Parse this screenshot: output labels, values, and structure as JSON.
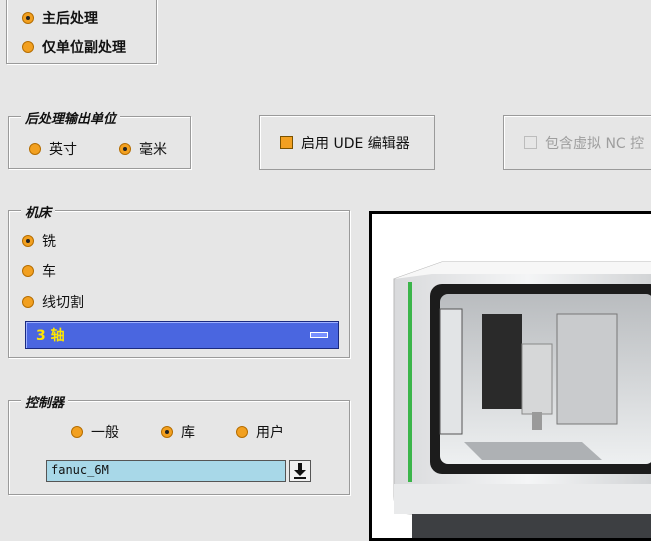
{
  "post_mode": {
    "options": [
      {
        "label": "主后处理",
        "checked": true
      },
      {
        "label": "仅单位副处理",
        "checked": false
      }
    ]
  },
  "units": {
    "title": "后处理输出单位",
    "options": [
      {
        "label": "英寸",
        "checked": false
      },
      {
        "label": "毫米",
        "checked": true
      }
    ]
  },
  "ude_button": {
    "label": "启用 UDE 编辑器",
    "checked": true
  },
  "nc_button": {
    "label": "包含虚拟 NC 控",
    "checked": false,
    "enabled": false
  },
  "machine": {
    "title": "机床",
    "options": [
      {
        "label": "铣",
        "checked": true
      },
      {
        "label": "车",
        "checked": false
      },
      {
        "label": "线切割",
        "checked": false
      }
    ],
    "axis_select": "3 轴"
  },
  "controller": {
    "title": "控制器",
    "options": [
      {
        "label": "一般",
        "checked": false
      },
      {
        "label": "库",
        "checked": true
      },
      {
        "label": "用户",
        "checked": false
      }
    ],
    "value": "fanuc_6M"
  },
  "colors": {
    "radio": "#f2a020",
    "select_bg": "#4a66e0",
    "select_text": "#ffe600",
    "field_bg": "#a8d8e8"
  }
}
